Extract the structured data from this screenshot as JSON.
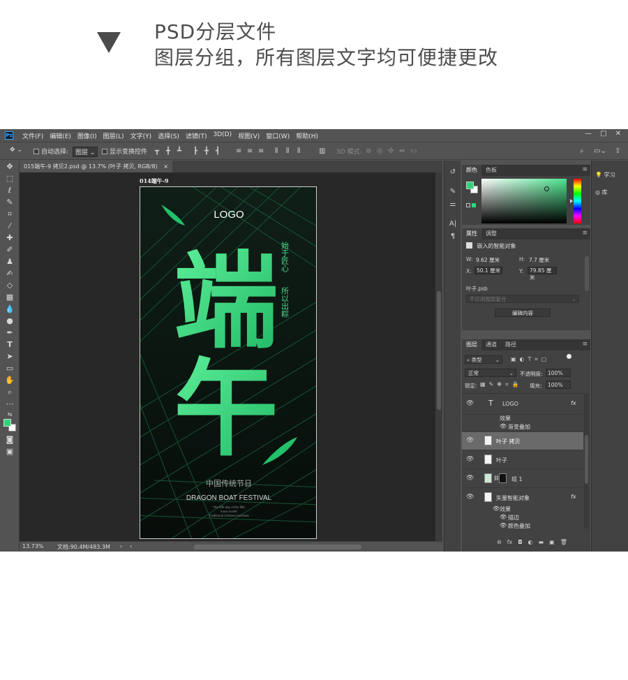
{
  "promo": {
    "line1": "PSD分层文件",
    "line2": "图层分组，所有图层文字均可便捷更改"
  },
  "app": {
    "logo": "Ps",
    "menu": [
      "文件(F)",
      "编辑(E)",
      "图像(I)",
      "图层(L)",
      "文字(Y)",
      "选择(S)",
      "滤镜(T)",
      "3D(D)",
      "视图(V)",
      "窗口(W)",
      "帮助(H)"
    ],
    "window_controls": [
      "—",
      "□",
      "✕"
    ]
  },
  "options_bar": {
    "auto_select": "自动选择:",
    "auto_select_value": "图层",
    "show_transform": "显示变换控件",
    "mode_3d": "3D 模式:"
  },
  "document": {
    "tab_title": "015端午-9 拷贝2.psd @ 13.7% (叶子 拷贝, RGB/8)",
    "tab_close": "×",
    "artboard_label": "014端午-9",
    "zoom": "13.73%",
    "doc_size": "文档:90.4M/483.3M"
  },
  "poster": {
    "logo": "LOGO",
    "big1": "端",
    "big2": "午",
    "side1": "始于匠心",
    "side2": "所以出粽",
    "cn_title": "中国传统节日",
    "en_title": "DRAGON BOAT FESTIVAL",
    "small1": "The fifth day of the fifth",
    "small2": "lunar month",
    "small3": "Traditional Chinese Festivals"
  },
  "color_panel": {
    "tabs": [
      "颜色",
      "色板"
    ],
    "fg_color": "#2fd47a",
    "hue_color": "#4be48e"
  },
  "properties_panel": {
    "tabs": [
      "属性",
      "调整"
    ],
    "type": "嵌入的智能对象",
    "w_label": "W:",
    "w_value": "9.62 厘米",
    "h_label": "H:",
    "h_value": "7.7 厘米",
    "x_label": "X:",
    "x_value": "50.1 厘米",
    "y_label": "Y:",
    "y_value": "79.85 厘米",
    "file": "叶子.psb",
    "comp_placeholder": "不应用图层复合",
    "edit_button": "编辑内容"
  },
  "layers_panel": {
    "tabs": [
      "图层",
      "通道",
      "路径"
    ],
    "filter": "类型",
    "blend": "正常",
    "opacity_label": "不透明度:",
    "opacity_value": "100%",
    "lock_label": "锁定:",
    "fill_label": "填充:",
    "fill_value": "100%",
    "layers": [
      {
        "name": "LOGO",
        "kind": "text",
        "fx": "fx"
      },
      {
        "name": "效果",
        "kind": "effects"
      },
      {
        "name": "渐变叠加",
        "kind": "effect"
      },
      {
        "name": "叶子 拷贝",
        "kind": "smart",
        "selected": true
      },
      {
        "name": "叶子",
        "kind": "smart"
      },
      {
        "name": "组 1",
        "kind": "group"
      },
      {
        "name": "矢量智能对象",
        "kind": "smart",
        "fx": "fx"
      },
      {
        "name": "效果",
        "kind": "effects"
      },
      {
        "name": "描边",
        "kind": "effect"
      },
      {
        "name": "颜色叠加",
        "kind": "effect"
      }
    ],
    "bottom_icons": [
      "⊖",
      "fx",
      "◘",
      "◐",
      "▬",
      "▣",
      "🗑"
    ]
  },
  "right_panels": {
    "learn": "学习",
    "library": "库"
  }
}
